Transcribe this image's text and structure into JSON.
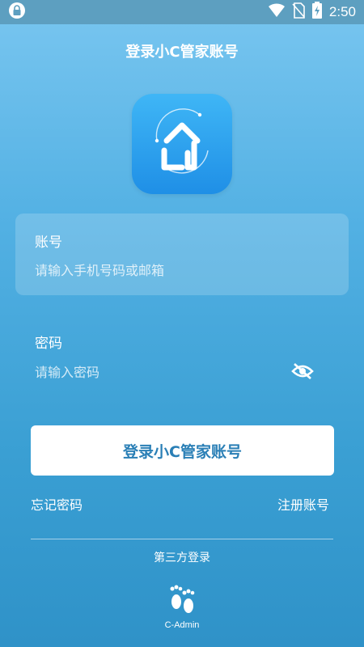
{
  "status_bar": {
    "time": "2:50",
    "icons": [
      "lock-icon",
      "wifi-icon",
      "no-sim-icon",
      "battery-charging-icon"
    ]
  },
  "header": {
    "title": "登录小C管家账号"
  },
  "logo": {
    "icon": "house-logo-icon"
  },
  "account_field": {
    "label": "账号",
    "placeholder": "请输入手机号码或邮箱",
    "value": ""
  },
  "password_field": {
    "label": "密码",
    "placeholder": "请输入密码",
    "value": "",
    "toggle_icon": "eye-hidden-icon"
  },
  "login_button": {
    "label": "登录小C管家账号"
  },
  "links": {
    "forgot_password": "忘记密码",
    "register": "注册账号"
  },
  "third_party": {
    "label": "第三方登录",
    "providers": [
      {
        "name": "C-Admin",
        "icon": "footprint-icon"
      }
    ]
  },
  "colors": {
    "accent": "#2a7fb6",
    "logo_bg": "#1f8fe6",
    "button_bg": "#ffffff"
  }
}
